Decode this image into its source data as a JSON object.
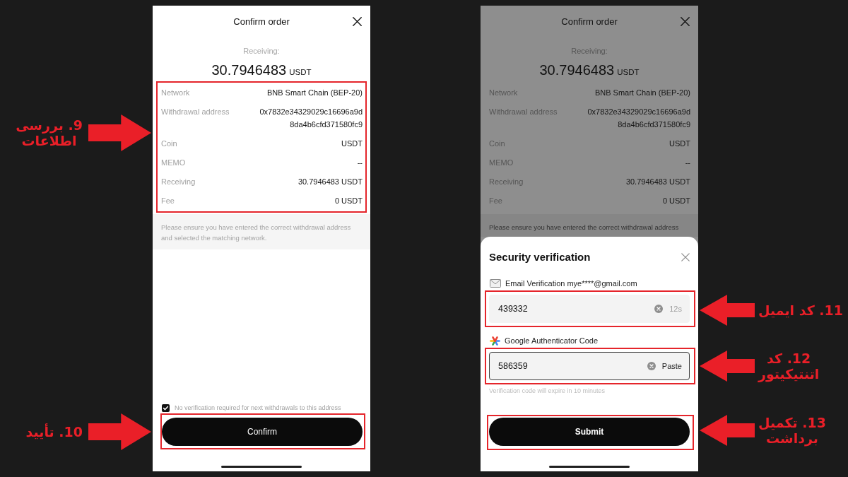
{
  "callouts": [
    {
      "text": "9. بررسی\nاطلاعات",
      "kind": "rightward"
    },
    {
      "text": "10. تأیید",
      "kind": "rightward"
    },
    {
      "text": "11. کد ایمیل",
      "kind": "leftward"
    },
    {
      "text": "12. کد\nاتنتیکیتور",
      "kind": "leftward"
    },
    {
      "text": "13. تکمیل\nبرداشت",
      "kind": "leftward"
    }
  ],
  "screens": [
    {
      "dimmed": false,
      "title": "Confirm order",
      "receiving_label": "Receiving:",
      "amount": "30.7946483",
      "amount_unit": "USDT",
      "details_highlighted": true,
      "details": [
        {
          "label": "Network",
          "value": "BNB Smart Chain (BEP-20)"
        },
        {
          "label": "Withdrawal address",
          "value": "0x7832e34329029c16696a9d8da4b6cfd371580fc9"
        },
        {
          "label": "Coin",
          "value": "USDT"
        },
        {
          "label": "MEMO",
          "value": "--"
        },
        {
          "label": "Receiving",
          "value": "30.7946483 USDT"
        },
        {
          "label": "Fee",
          "value": "0 USDT"
        }
      ],
      "notice": "Please ensure you have entered the correct withdrawal address and selected the matching network.",
      "checkbox": {
        "label": "No verification required for next withdrawals to this address",
        "checked": true
      },
      "confirm_button": {
        "label": "Confirm",
        "highlighted": true
      }
    },
    {
      "dimmed": true,
      "title": "Confirm order",
      "receiving_label": "Receiving:",
      "amount": "30.7946483",
      "amount_unit": "USDT",
      "details_highlighted": false,
      "details": [
        {
          "label": "Network",
          "value": "BNB Smart Chain (BEP-20)"
        },
        {
          "label": "Withdrawal address",
          "value": "0x7832e34329029c16696a9d8da4b6cfd371580fc9"
        },
        {
          "label": "Coin",
          "value": "USDT"
        },
        {
          "label": "MEMO",
          "value": "--"
        },
        {
          "label": "Receiving",
          "value": "30.7946483 USDT"
        },
        {
          "label": "Fee",
          "value": "0 USDT"
        }
      ],
      "notice": "Please ensure you have entered the correct withdrawal address",
      "sheet": {
        "title": "Security verification",
        "fields": [
          {
            "kind": "email",
            "label": "Email Verification mye****@gmail.com",
            "value": "439332",
            "suffix": "12s",
            "focused": false,
            "highlighted": true
          },
          {
            "kind": "authenticator",
            "label": "Google Authenticator Code",
            "value": "586359",
            "suffix": "Paste",
            "focused": true,
            "highlighted": true
          }
        ],
        "hint": "Verification code will expire in 10 minutes",
        "submit_button": {
          "label": "Submit",
          "highlighted": true
        }
      }
    }
  ]
}
